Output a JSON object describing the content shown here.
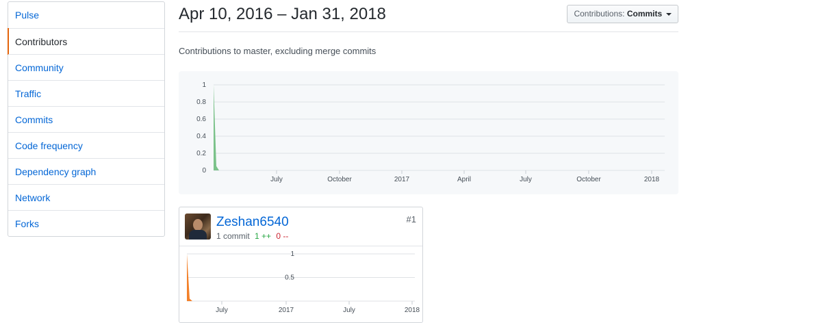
{
  "sidebar": {
    "items": [
      {
        "label": "Pulse",
        "selected": false
      },
      {
        "label": "Contributors",
        "selected": true
      },
      {
        "label": "Community",
        "selected": false
      },
      {
        "label": "Traffic",
        "selected": false
      },
      {
        "label": "Commits",
        "selected": false
      },
      {
        "label": "Code frequency",
        "selected": false
      },
      {
        "label": "Dependency graph",
        "selected": false
      },
      {
        "label": "Network",
        "selected": false
      },
      {
        "label": "Forks",
        "selected": false
      }
    ]
  },
  "header": {
    "date_range": "Apr 10, 2016 – Jan 31, 2018",
    "select_prefix": "Contributions:",
    "select_value": "Commits",
    "subtitle": "Contributions to master, excluding merge commits"
  },
  "colors": {
    "main_area": "#7bc28a",
    "contributor_area": "#f3812a",
    "accent_selected": "#e36209",
    "link": "#0366d6"
  },
  "chart_data": [
    {
      "type": "area",
      "series": [
        {
          "values": [
            1,
            0.05,
            0,
            0,
            0,
            0,
            0,
            0,
            0,
            0,
            0,
            0,
            0,
            0,
            0,
            0,
            0,
            0,
            0,
            0,
            0,
            0
          ]
        }
      ],
      "x_ticks": [
        "July",
        "October",
        "2017",
        "April",
        "July",
        "October",
        "2018"
      ],
      "y_ticks": [
        "0",
        "0.2",
        "0.4",
        "0.6",
        "0.8",
        "1"
      ],
      "ylim": [
        0,
        1
      ],
      "grid": true
    },
    {
      "type": "area",
      "series": [
        {
          "values": [
            1,
            0.05,
            0,
            0,
            0,
            0,
            0,
            0,
            0,
            0,
            0,
            0,
            0,
            0,
            0,
            0,
            0,
            0,
            0,
            0,
            0,
            0
          ]
        }
      ],
      "x_ticks": [
        "July",
        "2017",
        "July",
        "2018"
      ],
      "y_ticks": [
        "0.5",
        "1"
      ],
      "ylim": [
        0,
        1
      ],
      "grid": true
    }
  ],
  "contributor": {
    "username": "Zeshan6540",
    "commits": "1 commit",
    "additions": "1 ++",
    "deletions": "0 --",
    "rank": "#1"
  }
}
